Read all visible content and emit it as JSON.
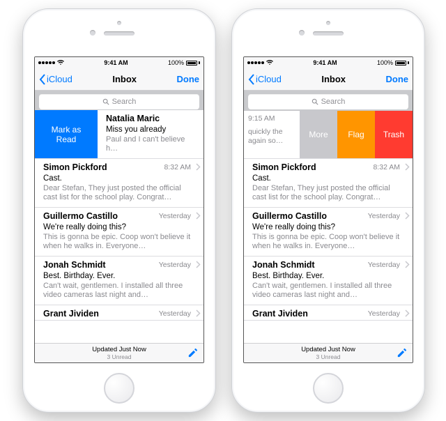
{
  "status": {
    "carrier": "",
    "time": "9:41 AM",
    "battery": "100%"
  },
  "nav": {
    "back": "iCloud",
    "title": "Inbox",
    "done": "Done"
  },
  "search": {
    "placeholder": "Search"
  },
  "swipe": {
    "mark_read": "Mark as\nRead",
    "more": "More",
    "flag": "Flag",
    "trash": "Trash",
    "stub_time": "9:15 AM",
    "stub_text": "quickly the again so…"
  },
  "messages": [
    {
      "sender": "Natalia Maric",
      "time": "",
      "subject": "Miss you already",
      "preview": "Paul and I can't believe how quickly the week went by. Come visit again so…"
    },
    {
      "sender": "Simon Pickford",
      "time": "8:32 AM",
      "subject": "Cast.",
      "preview": "Dear Stefan, They just posted the official cast list for the school play. Congrat…"
    },
    {
      "sender": "Guillermo Castillo",
      "time": "Yesterday",
      "subject": "We're really doing this?",
      "preview": "This is gonna be epic. Coop won't believe it when he walks in. Everyone…"
    },
    {
      "sender": "Jonah Schmidt",
      "time": "Yesterday",
      "subject": "Best. Birthday. Ever.",
      "preview": "Can't wait, gentlemen. I installed all three video cameras last night and…"
    },
    {
      "sender": "Grant Jividen",
      "time": "Yesterday",
      "subject": "",
      "preview": ""
    }
  ],
  "toolbar": {
    "status": "Updated Just Now",
    "unread": "3 Unread"
  }
}
